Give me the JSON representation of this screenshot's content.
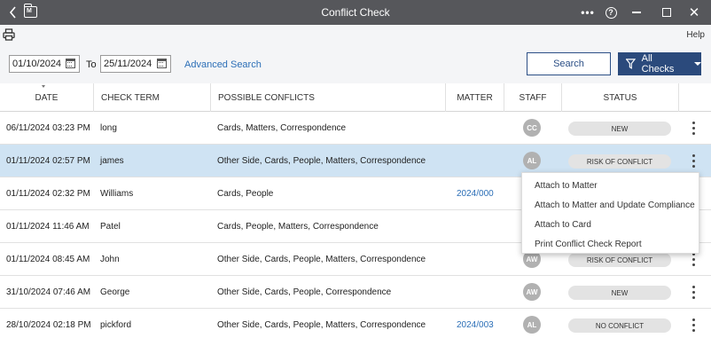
{
  "window": {
    "title": "Conflict Check",
    "app_icon_letter": "M"
  },
  "toolbar": {
    "help_label": "Help"
  },
  "filters": {
    "date_from": "01/10/2024",
    "to_label": "To",
    "date_to": "25/11/2024",
    "advanced_search": "Advanced Search",
    "search_button": "Search",
    "filter_button": "All Checks"
  },
  "table": {
    "headers": {
      "date": "DATE",
      "check_term": "CHECK TERM",
      "possible_conflicts": "POSSIBLE CONFLICTS",
      "matter": "MATTER",
      "staff": "STAFF",
      "status": "STATUS"
    },
    "rows": [
      {
        "date": "06/11/2024 03:23 PM",
        "term": "long",
        "conflicts": "Cards, Matters, Correspondence",
        "matter": "",
        "staff": "CC",
        "status": "NEW"
      },
      {
        "date": "01/11/2024 02:57 PM",
        "term": "james",
        "conflicts": "Other Side, Cards, People, Matters, Correspondence",
        "matter": "",
        "staff": "AL",
        "status": "RISK OF CONFLICT"
      },
      {
        "date": "01/11/2024 02:32 PM",
        "term": "Williams",
        "conflicts": "Cards, People",
        "matter": "2024/000",
        "staff": "",
        "status": ""
      },
      {
        "date": "01/11/2024 11:46 AM",
        "term": "Patel",
        "conflicts": "Cards, People, Matters, Correspondence",
        "matter": "",
        "staff": "",
        "status": ""
      },
      {
        "date": "01/11/2024 08:45 AM",
        "term": "John",
        "conflicts": "Other Side, Cards, People, Matters, Correspondence",
        "matter": "",
        "staff": "AW",
        "status": "RISK OF CONFLICT"
      },
      {
        "date": "31/10/2024 07:46 AM",
        "term": "George",
        "conflicts": "Other Side, Cards, People, Correspondence",
        "matter": "",
        "staff": "AW",
        "status": "NEW"
      },
      {
        "date": "28/10/2024 02:18 PM",
        "term": "pickford",
        "conflicts": "Other Side, Cards, People, Matters, Correspondence",
        "matter": "2024/003",
        "staff": "AL",
        "status": "NO CONFLICT"
      }
    ]
  },
  "context_menu": {
    "items": [
      "Attach to Matter",
      "Attach to Matter and Update Compliance",
      "Attach to Card",
      "Print Conflict Check Report"
    ]
  },
  "colors": {
    "titlebar": "#56575b",
    "accent": "#2b4a7c",
    "link": "#2c6fb7",
    "selected_row": "#cfe3f3"
  }
}
